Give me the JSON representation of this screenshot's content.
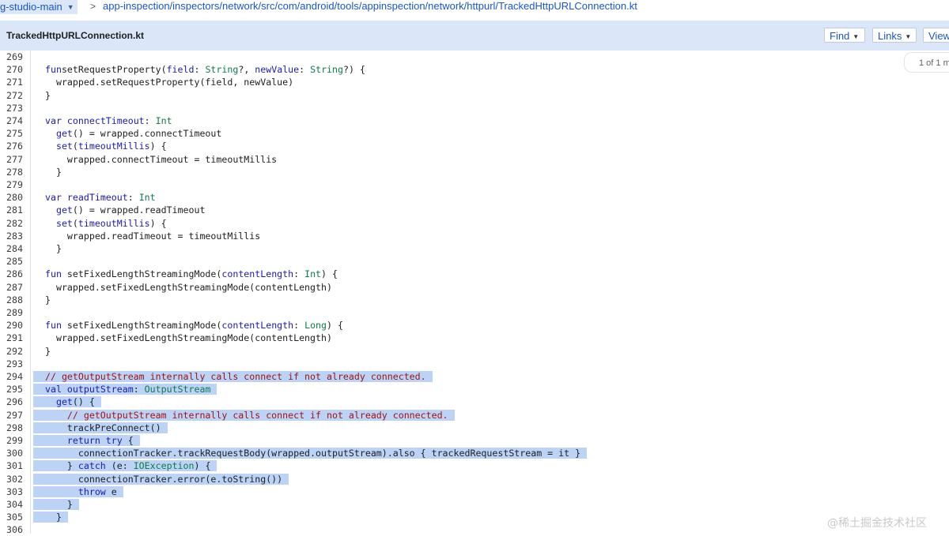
{
  "breadcrumb": {
    "branch": "g-studio-main",
    "separator": ">",
    "path": "app-inspection/inspectors/network/src/com/android/tools/appinspection/network/httpurl/TrackedHttpURLConnection.kt"
  },
  "file": {
    "name": "TrackedHttpURLConnection.kt",
    "find_label": "Find",
    "links_label": "Links",
    "view_label": "View",
    "match_count": "1 of 1 m"
  },
  "code": {
    "lines": [
      {
        "n": "269",
        "segs": [],
        "hl": false
      },
      {
        "n": "270",
        "segs": [
          [
            "kw",
            "fun"
          ],
          [
            "",
            "setRequestProperty("
          ],
          [
            "pn",
            "field"
          ],
          [
            "",
            ": "
          ],
          [
            "ty",
            "String"
          ],
          [
            "",
            "?, "
          ],
          [
            "pn",
            "newValue"
          ],
          [
            "",
            ": "
          ],
          [
            "ty",
            "String"
          ],
          [
            "",
            "?) {"
          ]
        ],
        "hl": false
      },
      {
        "n": "271",
        "segs": [
          [
            "",
            "  wrapped.setRequestProperty(field, newValue)"
          ]
        ],
        "hl": false
      },
      {
        "n": "272",
        "segs": [
          [
            "",
            "}"
          ]
        ],
        "hl": false
      },
      {
        "n": "273",
        "segs": [],
        "hl": false
      },
      {
        "n": "274",
        "segs": [
          [
            "kw",
            "var"
          ],
          [
            "",
            ""
          ],
          [
            "pn",
            " connectTimeout"
          ],
          [
            "",
            ": "
          ],
          [
            "ty",
            "Int"
          ]
        ],
        "hl": false
      },
      {
        "n": "275",
        "segs": [
          [
            "kw",
            "  get"
          ],
          [
            "",
            "() = wrapped.connectTimeout"
          ]
        ],
        "hl": false
      },
      {
        "n": "276",
        "segs": [
          [
            "kw",
            "  set"
          ],
          [
            "",
            "("
          ],
          [
            "pn",
            "timeoutMillis"
          ],
          [
            "",
            ") {"
          ]
        ],
        "hl": false
      },
      {
        "n": "277",
        "segs": [
          [
            "",
            "    wrapped.connectTimeout = timeoutMillis"
          ]
        ],
        "hl": false
      },
      {
        "n": "278",
        "segs": [
          [
            "",
            "  }"
          ]
        ],
        "hl": false
      },
      {
        "n": "279",
        "segs": [],
        "hl": false
      },
      {
        "n": "280",
        "segs": [
          [
            "kw",
            "var"
          ],
          [
            "pn",
            " readTimeout"
          ],
          [
            "",
            ": "
          ],
          [
            "ty",
            "Int"
          ]
        ],
        "hl": false
      },
      {
        "n": "281",
        "segs": [
          [
            "kw",
            "  get"
          ],
          [
            "",
            "() = wrapped.readTimeout"
          ]
        ],
        "hl": false
      },
      {
        "n": "282",
        "segs": [
          [
            "kw",
            "  set"
          ],
          [
            "",
            "("
          ],
          [
            "pn",
            "timeoutMillis"
          ],
          [
            "",
            ") {"
          ]
        ],
        "hl": false
      },
      {
        "n": "283",
        "segs": [
          [
            "",
            "    wrapped.readTimeout = timeoutMillis"
          ]
        ],
        "hl": false
      },
      {
        "n": "284",
        "segs": [
          [
            "",
            "  }"
          ]
        ],
        "hl": false
      },
      {
        "n": "285",
        "segs": [],
        "hl": false
      },
      {
        "n": "286",
        "segs": [
          [
            "kw",
            "fun"
          ],
          [
            "",
            ""
          ],
          [
            "",
            " setFixedLengthStreamingMode("
          ],
          [
            "pn",
            "contentLength"
          ],
          [
            "",
            ": "
          ],
          [
            "ty",
            "Int"
          ],
          [
            "",
            ") {"
          ]
        ],
        "hl": false
      },
      {
        "n": "287",
        "segs": [
          [
            "",
            "  wrapped.setFixedLengthStreamingMode(contentLength)"
          ]
        ],
        "hl": false
      },
      {
        "n": "288",
        "segs": [
          [
            "",
            "}"
          ]
        ],
        "hl": false
      },
      {
        "n": "289",
        "segs": [],
        "hl": false
      },
      {
        "n": "290",
        "segs": [
          [
            "kw",
            "fun"
          ],
          [
            "",
            " setFixedLengthStreamingMode("
          ],
          [
            "pn",
            "contentLength"
          ],
          [
            "",
            ": "
          ],
          [
            "ty",
            "Long"
          ],
          [
            "",
            ") {"
          ]
        ],
        "hl": false
      },
      {
        "n": "291",
        "segs": [
          [
            "",
            "  wrapped.setFixedLengthStreamingMode(contentLength)"
          ]
        ],
        "hl": false
      },
      {
        "n": "292",
        "segs": [
          [
            "",
            "}"
          ]
        ],
        "hl": false
      },
      {
        "n": "293",
        "segs": [],
        "hl": false
      },
      {
        "n": "294",
        "segs": [
          [
            "cm",
            "// getOutputStream internally calls connect if not already connected."
          ]
        ],
        "hl": true
      },
      {
        "n": "295",
        "segs": [
          [
            "kw",
            "val"
          ],
          [
            "pn",
            " outputStream"
          ],
          [
            "",
            ": "
          ],
          [
            "ty",
            "OutputStream"
          ]
        ],
        "hl": true
      },
      {
        "n": "296",
        "segs": [
          [
            "kw",
            "  get"
          ],
          [
            "",
            "() {"
          ]
        ],
        "hl": true
      },
      {
        "n": "297",
        "segs": [
          [
            "cm",
            "    // getOutputStream internally calls connect if not already connected."
          ]
        ],
        "hl": true
      },
      {
        "n": "298",
        "segs": [
          [
            "",
            "    trackPreConnect()"
          ]
        ],
        "hl": true
      },
      {
        "n": "299",
        "segs": [
          [
            "kw",
            "    return try"
          ],
          [
            "",
            " {"
          ]
        ],
        "hl": true
      },
      {
        "n": "300",
        "segs": [
          [
            "",
            "      connectionTracker.trackRequestBody(wrapped.outputStream).also { trackedRequestStream = it }"
          ]
        ],
        "hl": true
      },
      {
        "n": "301",
        "segs": [
          [
            "",
            "    } "
          ],
          [
            "kw",
            "catch"
          ],
          [
            "",
            " (e: "
          ],
          [
            "ty",
            "IOException"
          ],
          [
            "",
            ") {"
          ]
        ],
        "hl": true
      },
      {
        "n": "302",
        "segs": [
          [
            "",
            "      connectionTracker.error(e.toString())"
          ]
        ],
        "hl": true
      },
      {
        "n": "303",
        "segs": [
          [
            "kw",
            "      throw"
          ],
          [
            "",
            " e"
          ]
        ],
        "hl": true
      },
      {
        "n": "304",
        "segs": [
          [
            "",
            "    }"
          ]
        ],
        "hl": true
      },
      {
        "n": "305",
        "segs": [
          [
            "",
            "  }"
          ]
        ],
        "hl": true
      },
      {
        "n": "306",
        "segs": [],
        "hl": false
      }
    ]
  },
  "watermark": "@稀土掘金技术社区"
}
